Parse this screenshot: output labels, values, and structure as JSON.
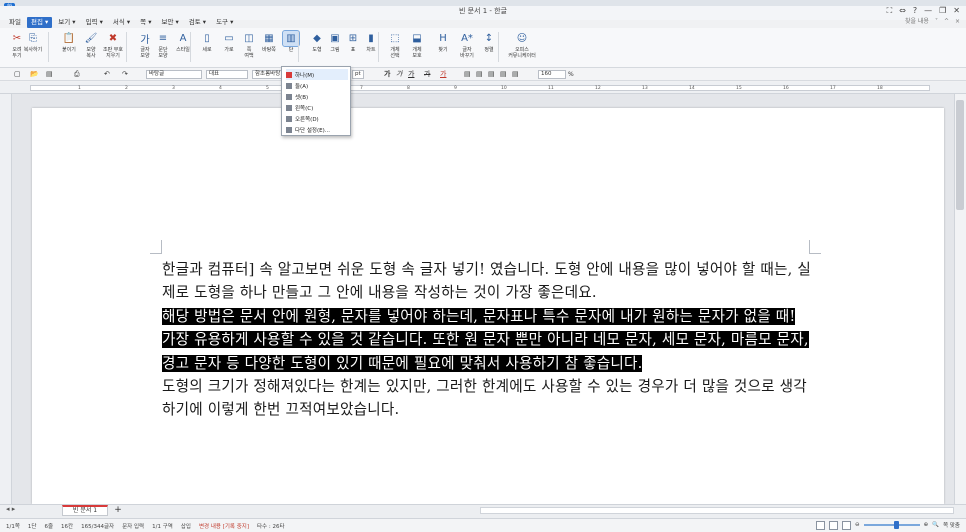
{
  "app": {
    "title": "빈 문서 1 - 한글",
    "window_controls": [
      "⛶",
      "⇔",
      "?",
      "—",
      "❐",
      "✕"
    ]
  },
  "menu": {
    "items": [
      {
        "label": "파일",
        "active": false
      },
      {
        "label": "편집 ▾",
        "active": true
      },
      {
        "label": "보기 ▾",
        "active": false
      },
      {
        "label": "입력 ▾",
        "active": false
      },
      {
        "label": "서식 ▾",
        "active": false
      },
      {
        "label": "쪽 ▾",
        "active": false
      },
      {
        "label": "보안 ▾",
        "active": false
      },
      {
        "label": "검토 ▾",
        "active": false
      },
      {
        "label": "도구 ▾",
        "active": false
      }
    ],
    "right": [
      "찾을 내용",
      "˅",
      "^",
      "×"
    ]
  },
  "ribbon": {
    "buttons": [
      {
        "label": "오려\n두기",
        "icon": "scissors-icon",
        "glyph": "✂"
      },
      {
        "label": "복사하기",
        "icon": "copy-icon",
        "glyph": "⎘"
      },
      {
        "label": "붙이기",
        "icon": "paste-icon",
        "glyph": "📋"
      },
      {
        "label": "모양\n복사",
        "icon": "format-copy-icon",
        "glyph": "🖌"
      },
      {
        "label": "조판 부호\n지우기",
        "icon": "clear-code-icon",
        "glyph": "✖"
      },
      {
        "label": "글자\n모양",
        "icon": "char-shape-icon",
        "glyph": "가"
      },
      {
        "label": "문단\n모양",
        "icon": "para-shape-icon",
        "glyph": "≡"
      },
      {
        "label": "스타일",
        "icon": "style-icon",
        "glyph": "A"
      },
      {
        "label": "세로",
        "icon": "portrait-icon",
        "glyph": "▯"
      },
      {
        "label": "가로",
        "icon": "landscape-icon",
        "glyph": "▭"
      },
      {
        "label": "쪽\n여백",
        "icon": "margin-icon",
        "glyph": "◫"
      },
      {
        "label": "바탕쪽",
        "icon": "master-page-icon",
        "glyph": "▦"
      },
      {
        "label": "단",
        "icon": "columns-icon",
        "glyph": "▥"
      },
      {
        "label": "도형",
        "icon": "shape-icon",
        "glyph": "◆"
      },
      {
        "label": "그림",
        "icon": "picture-icon",
        "glyph": "▣"
      },
      {
        "label": "표",
        "icon": "table-icon",
        "glyph": "⊞"
      },
      {
        "label": "차트",
        "icon": "chart-icon",
        "glyph": "▮"
      },
      {
        "label": "개체\n선택",
        "icon": "select-object-icon",
        "glyph": "⬚"
      },
      {
        "label": "개체\n보호",
        "icon": "protect-object-icon",
        "glyph": "⬓"
      },
      {
        "label": "찾기",
        "icon": "find-icon",
        "glyph": "H"
      },
      {
        "label": "글자\n바꾸기",
        "icon": "replace-icon",
        "glyph": "A*"
      },
      {
        "label": "정렬",
        "icon": "sort-icon",
        "glyph": "↕"
      },
      {
        "label": "오피스\n커뮤니케이터",
        "icon": "communicator-icon",
        "glyph": "☺"
      }
    ]
  },
  "format_bar": {
    "style": "바탕글",
    "lang": "대표",
    "font": "함초롬바탕",
    "size": "10.0",
    "pt": "pt",
    "bold": "가",
    "italic": "가",
    "underline": "가",
    "strike": "가",
    "color": "가",
    "zoom": "160",
    "zoom_unit": "%"
  },
  "ruler": {
    "ticks": [
      "1",
      "2",
      "3",
      "4",
      "5",
      "6",
      "7",
      "8",
      "9",
      "10",
      "11",
      "12",
      "13",
      "14",
      "15",
      "16",
      "17",
      "18"
    ]
  },
  "columns_dropdown": {
    "items": [
      {
        "label": "하나(M)",
        "checked": true
      },
      {
        "label": "둘(A)",
        "checked": false
      },
      {
        "label": "셋(B)",
        "checked": false
      },
      {
        "label": "왼쪽(C)",
        "checked": false
      },
      {
        "label": "오른쪽(D)",
        "checked": false
      },
      {
        "label": "다단 설정(E)...",
        "checked": false
      }
    ]
  },
  "document": {
    "p1": "한글과 컴퓨터] 속 알고보면 쉬운 도형 속 글자 넣기! 였습니다. 도형 안에 내용을 많이 넣어야 할 때는, 실제로 도형을 하나 만들고 그 안에 내용을 작성하는 것이 가장 좋은데요.",
    "p2_selected": "해당 방법은 문서 안에 원형, 문자를 넣어야 하는데, 문자표나 특수 문자에 내가 원하는 문자가 없을 때! 가장 유용하게 사용할 수 있을 것 같습니다. 또한 원 문자 뿐만 아니라 네모 문자, 세모 문자, 마름모 문자, 경고 문자 등 다양한 도형이 있기 때문에 필요에 맞춰서 사용하기 참 좋습니다.",
    "p3": "도형의 크기가 정해져있다는 한계는 있지만, 그러한 한계에도 사용할 수 있는 경우가 더 많을 것으로 생각하기에 이렇게 한번 끄적여보았습니다."
  },
  "tabs": {
    "doc_tab": "빈 문서 1",
    "add": "+"
  },
  "status": {
    "items": [
      "1/1쪽",
      "1단",
      "6줄",
      "16칸",
      "165/344글자",
      "문자 입력",
      "1/1 구역",
      "삽입",
      "변경 내용 [기록 중지]",
      "타수 : 26타"
    ],
    "zoom_text": "쪽 맞춤"
  },
  "colors": {
    "accent": "#2f6fc9",
    "selection_bg": "#000000",
    "tab_marker": "#d83a3a"
  }
}
